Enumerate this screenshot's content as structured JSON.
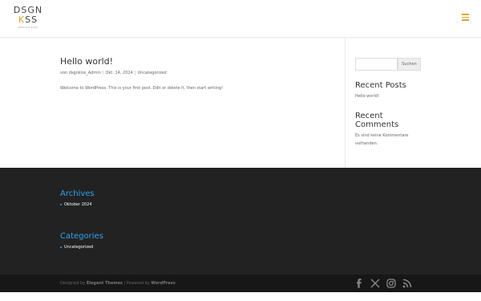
{
  "logo": {
    "line1": "DSGN",
    "line2_k": "K",
    "line2_rest": "SS",
    "tagline": "DESIGN KISS"
  },
  "post": {
    "title": "Hello world!",
    "meta_by": "von",
    "author": "dsgnkiss_Admin",
    "date": "Okt. 14, 2024",
    "category": "Uncategorized",
    "excerpt": "Welcome to WordPress. This is your first post. Edit or delete it, then start writing!"
  },
  "sidebar": {
    "search_placeholder": "",
    "search_button": "Suchen",
    "recent_posts_title": "Recent Posts",
    "recent_posts": [
      "Hello world!"
    ],
    "recent_comments_title_1": "Recent",
    "recent_comments_title_2": "Comments",
    "no_comments_1": "Es sind keine Kommentare",
    "no_comments_2": "vorhanden."
  },
  "footer": {
    "archives_title": "Archives",
    "archives": [
      "Oktober 2024"
    ],
    "categories_title": "Categories",
    "categories": [
      "Uncategorized"
    ]
  },
  "bottom": {
    "designed_by": "Designed by",
    "elegant": "Elegant Themes",
    "powered_by": "Powered by",
    "wordpress": "WordPress",
    "separator": "|"
  },
  "social_icons": [
    "facebook-icon",
    "x-icon",
    "instagram-icon",
    "rss-icon"
  ],
  "colors": {
    "accent": "#e0a52a",
    "link_blue": "#2ea3f2",
    "footer_bg": "#222222",
    "bottom_bg": "#171717"
  }
}
